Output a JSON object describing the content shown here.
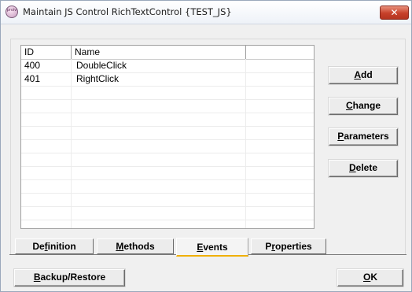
{
  "window": {
    "title": "Maintain JS Control RichTextControl {TEST_JS}",
    "app_icon_text": "proiv",
    "close_glyph": "✕"
  },
  "events_list": {
    "columns": [
      "ID",
      "Name"
    ],
    "rows": [
      {
        "id": "400",
        "name": "DoubleClick"
      },
      {
        "id": "401",
        "name": "RightClick"
      }
    ]
  },
  "side_buttons": {
    "add": {
      "mnemonic": "A",
      "rest": "dd"
    },
    "change": {
      "mnemonic": "C",
      "rest": "hange"
    },
    "parameters": {
      "mnemonic": "P",
      "rest": "arameters"
    },
    "delete": {
      "mnemonic": "D",
      "rest": "elete"
    }
  },
  "tabs": {
    "definition": {
      "pre": "De",
      "mnemonic": "f",
      "post": "inition"
    },
    "methods": {
      "pre": "",
      "mnemonic": "M",
      "post": "ethods"
    },
    "events": {
      "pre": "",
      "mnemonic": "E",
      "post": "vents"
    },
    "properties": {
      "pre": "P",
      "mnemonic": "r",
      "post": "operties"
    },
    "active": "events"
  },
  "footer": {
    "backup": {
      "mnemonic": "B",
      "rest": "ackup/Restore"
    },
    "ok": {
      "mnemonic": "O",
      "rest": "K"
    }
  },
  "colors": {
    "close_button": "#c7402a",
    "active_tab_underline": "#f0b000"
  }
}
